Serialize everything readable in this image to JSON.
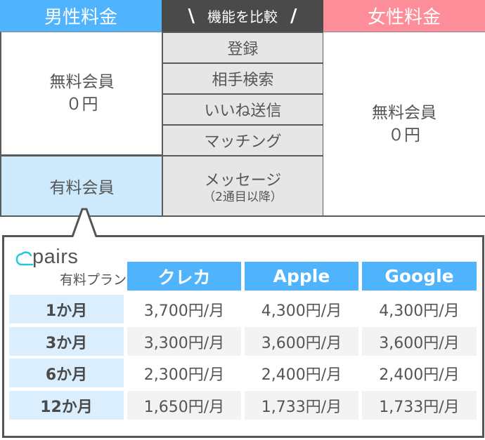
{
  "header": {
    "male_title": "男性料金",
    "compare_title": "機能を比較",
    "female_title": "女性料金",
    "left_deco": "\\",
    "right_deco": "/"
  },
  "male": {
    "free_label": "無料会員",
    "free_price": "０円",
    "paid_label": "有料会員"
  },
  "female": {
    "free_label": "無料会員",
    "free_price": "０円"
  },
  "features": [
    {
      "label": "登録"
    },
    {
      "label": "相手検索"
    },
    {
      "label": "いいね送信"
    },
    {
      "label": "マッチング"
    },
    {
      "label": "メッセージ",
      "sub": "（2通目以降）"
    }
  ],
  "pricing": {
    "logo_text": "pairs",
    "plan_label": "有料プラン",
    "columns": [
      "クレカ",
      "Apple",
      "Google"
    ],
    "rows": [
      {
        "period": "1か月",
        "prices": [
          "3,700円/月",
          "4,300円/月",
          "4,300円/月"
        ]
      },
      {
        "period": "3か月",
        "prices": [
          "3,300円/月",
          "3,600円/月",
          "3,600円/月"
        ]
      },
      {
        "period": "6か月",
        "prices": [
          "2,300円/月",
          "2,400円/月",
          "2,400円/月"
        ]
      },
      {
        "period": "12か月",
        "prices": [
          "1,650円/月",
          "1,733円/月",
          "1,733円/月"
        ]
      }
    ]
  },
  "colors": {
    "male_accent": "#4fb3fd",
    "female_accent": "#fd8d99",
    "header_dark": "#4a4a4a",
    "paid_bg": "#cdeafd",
    "logo_cloud": "#1ec8e0"
  }
}
